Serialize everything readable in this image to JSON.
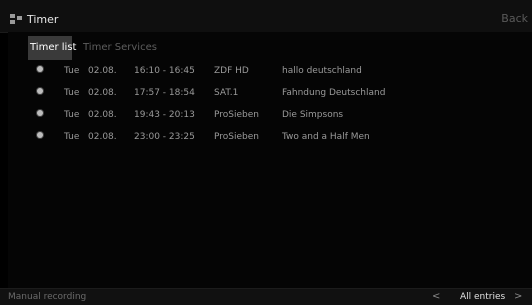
{
  "header": {
    "title": "Timer",
    "back_label": "Back",
    "app_icon": "grid-icon"
  },
  "tabs": [
    {
      "label": "Timer list",
      "active": true
    },
    {
      "label": "Timer Services",
      "active": false
    }
  ],
  "timers": [
    {
      "day": "Tue",
      "date": "02.08.",
      "time": "16:10 - 16:45",
      "channel": "ZDF HD",
      "title": "hallo deutschland"
    },
    {
      "day": "Tue",
      "date": "02.08.",
      "time": "17:57 - 18:54",
      "channel": "SAT.1",
      "title": "Fahndung Deutschland"
    },
    {
      "day": "Tue",
      "date": "02.08.",
      "time": "19:43 - 20:13",
      "channel": "ProSieben",
      "title": "Die Simpsons"
    },
    {
      "day": "Tue",
      "date": "02.08.",
      "time": "23:00 - 23:25",
      "channel": "ProSieben",
      "title": "Two and a Half Men"
    }
  ],
  "footer": {
    "manual_label": "Manual recording",
    "prev_icon": "<",
    "entries_label": "All entries",
    "next_icon": ">"
  },
  "colors": {
    "accent_tab": "#3a3a3a",
    "background": "#000000"
  }
}
